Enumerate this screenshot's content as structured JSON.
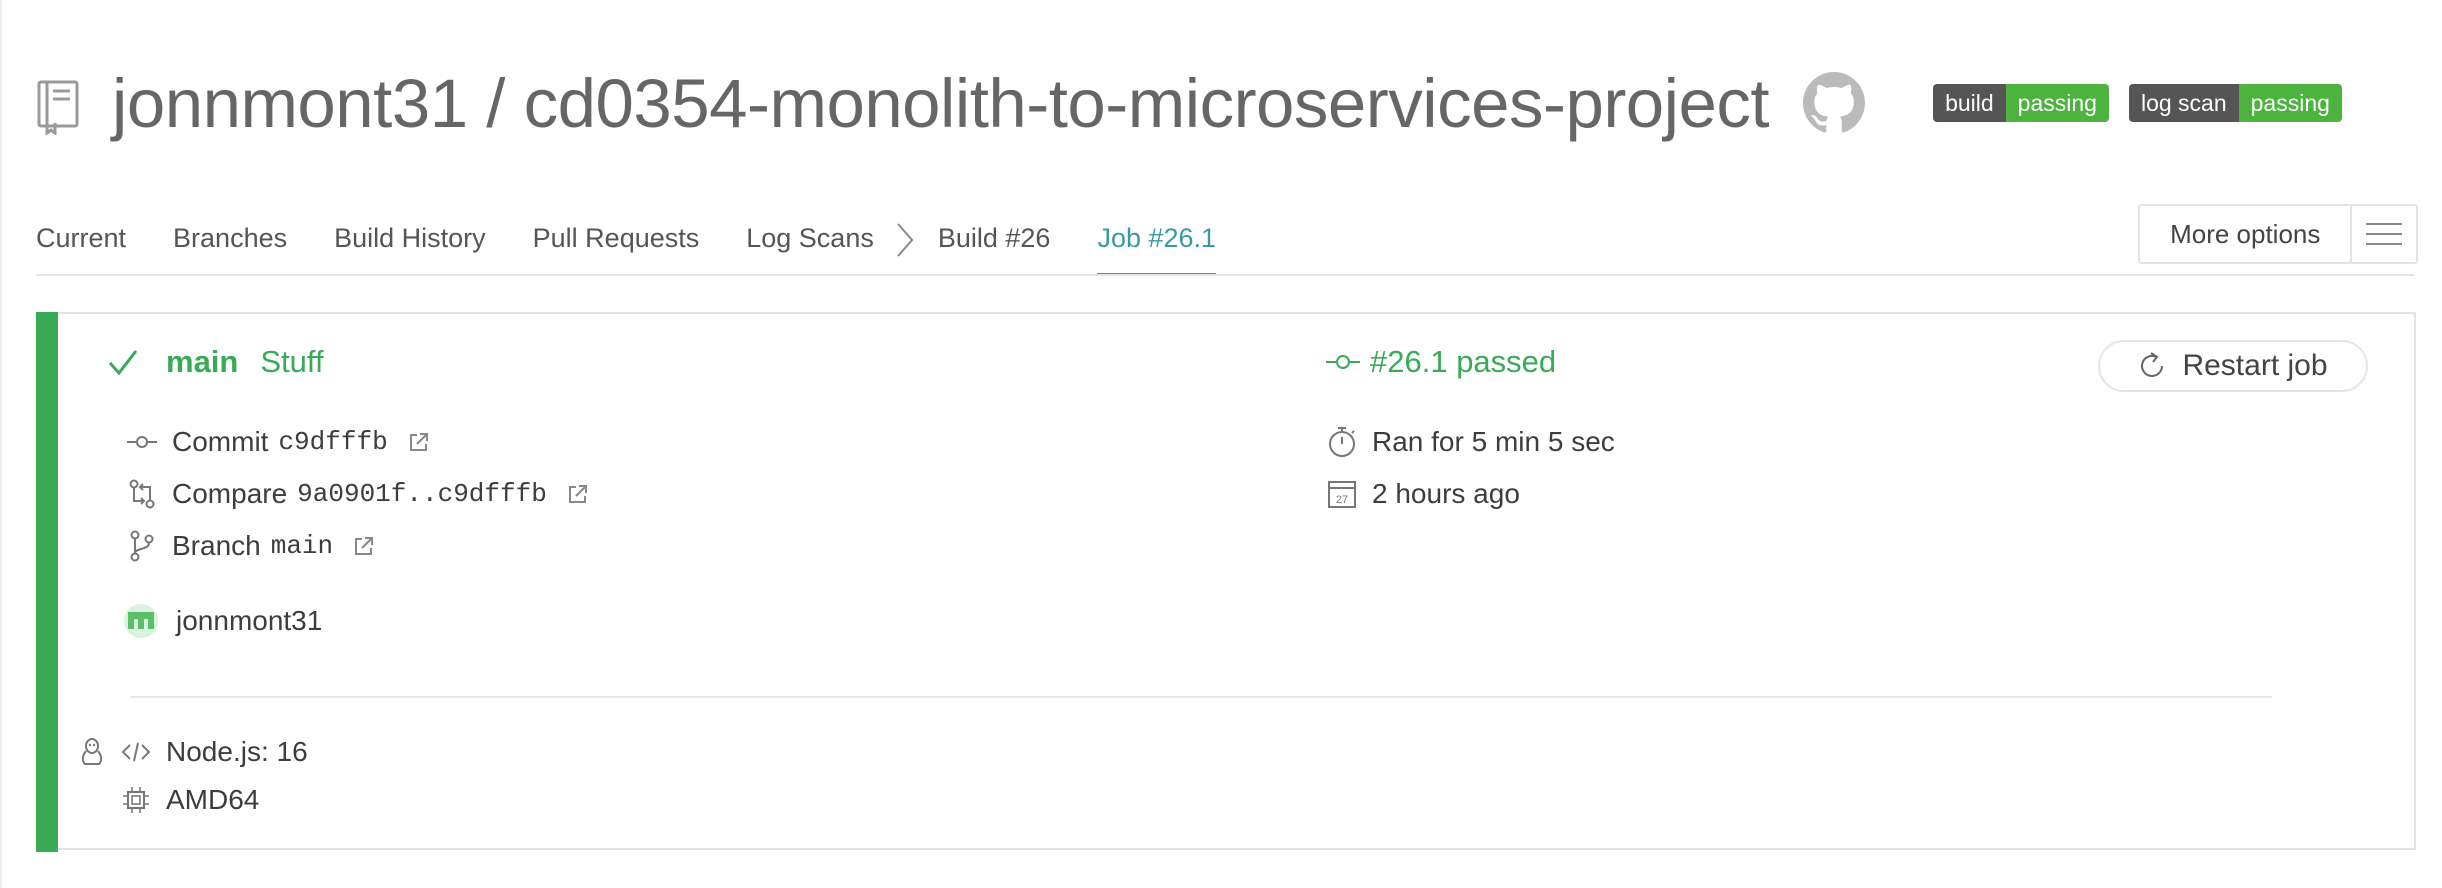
{
  "header": {
    "repo_title": "jonnmont31 / cd0354-monolith-to-microservices-project",
    "badges": [
      {
        "left": "build",
        "right": "passing"
      },
      {
        "left": "log scan",
        "right": "passing"
      }
    ]
  },
  "tabs": {
    "current": "Current",
    "branches": "Branches",
    "build_history": "Build History",
    "pull_requests": "Pull Requests",
    "log_scans": "Log Scans",
    "build": "Build #26",
    "job": "Job #26.1"
  },
  "more_options": "More options",
  "job": {
    "branch": "main",
    "message": "Stuff",
    "state": "#26.1 passed",
    "restart_label": "Restart job",
    "commit_label": "Commit",
    "commit_value": "c9dfffb",
    "compare_label": "Compare",
    "compare_value": "9a0901f..c9dfffb",
    "branch_label": "Branch",
    "branch_value": "main",
    "author": "jonnmont31",
    "duration": "Ran for 5 min 5 sec",
    "finished": "2 hours ago",
    "calendar_day": "27",
    "language": "Node.js: 16",
    "arch": "AMD64"
  },
  "colors": {
    "passed": "#39aa56",
    "active_tab": "#399aa0",
    "badge_dark": "#555555",
    "badge_green": "#4cb33f"
  },
  "icons": [
    "repo-icon",
    "github-icon",
    "chevron-right-icon",
    "hamburger-icon",
    "check-icon",
    "commit-icon",
    "restart-icon",
    "compare-icon",
    "branch-icon",
    "external-link-icon",
    "stopwatch-icon",
    "calendar-icon",
    "linux-icon",
    "code-icon",
    "cpu-icon"
  ]
}
